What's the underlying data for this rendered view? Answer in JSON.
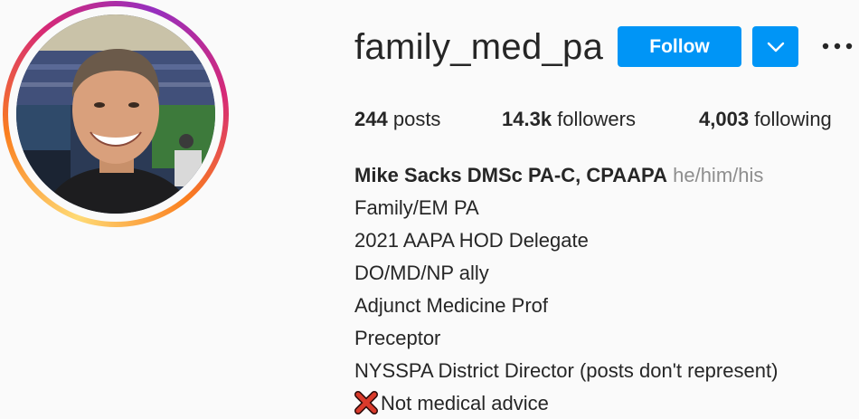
{
  "profile": {
    "username": "family_med_pa",
    "follow_label": "Follow",
    "dropdown_icon": "chevron-down-icon",
    "more_icon": "more-options-icon",
    "accent_color": "#0095f6"
  },
  "stats": {
    "posts": {
      "count": "244",
      "label": "posts"
    },
    "followers": {
      "count": "14.3k",
      "label": "followers"
    },
    "following": {
      "count": "4,003",
      "label": "following"
    }
  },
  "bio": {
    "full_name": "Mike Sacks DMSc PA-C, CPAAPA",
    "pronouns": "he/him/his",
    "lines": [
      "Family/EM PA",
      "2021 AAPA HOD Delegate",
      "DO/MD/NP ally",
      "Adjunct Medicine Prof",
      "Preceptor",
      "NYSSPA District Director (posts don't represent)"
    ],
    "last_line_icon": "cross-mark-icon",
    "last_line_text": "Not medical advice"
  }
}
